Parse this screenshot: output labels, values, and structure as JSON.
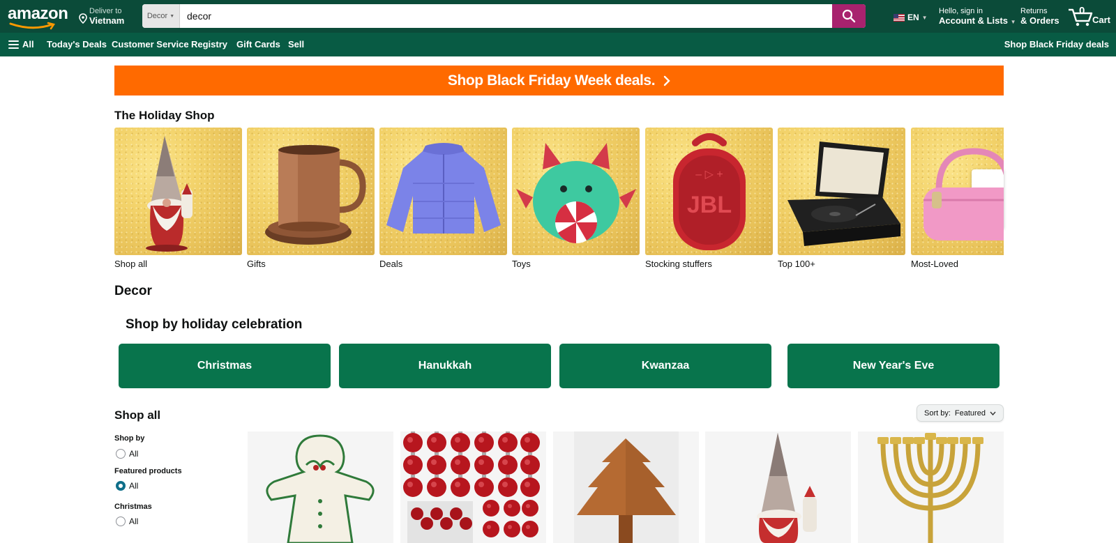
{
  "header": {
    "logo": "amazon",
    "deliver_line1": "Deliver to",
    "deliver_line2": "Vietnam",
    "search_department": "Decor",
    "search_value": "decor",
    "language": "EN",
    "account_line1": "Hello, sign in",
    "account_line2": "Account & Lists",
    "returns_line1": "Returns",
    "returns_line2": "& Orders",
    "cart_count": "0",
    "cart_label": "Cart"
  },
  "nav": {
    "all": "All",
    "items": [
      "Today's Deals",
      "Customer Service",
      "Registry",
      "Gift Cards",
      "Sell"
    ],
    "right": "Shop Black Friday deals"
  },
  "banner": {
    "text": "Shop Black Friday Week deals."
  },
  "holiday_shop": {
    "title": "The Holiday Shop",
    "cards": [
      "Shop all",
      "Gifts",
      "Deals",
      "Toys",
      "Stocking stuffers",
      "Top 100+",
      "Most-Loved"
    ]
  },
  "decor": {
    "title": "Decor",
    "celebration_title": "Shop by holiday celebration",
    "celebrations": [
      "Christmas",
      "Hanukkah",
      "Kwanzaa",
      "New Year's Eve"
    ]
  },
  "shop_all": {
    "title": "Shop all",
    "sort_label": "Sort by:",
    "sort_value": "Featured",
    "filters": [
      {
        "heading": "Shop by",
        "option": "All",
        "selected": false
      },
      {
        "heading": "Featured products",
        "option": "All",
        "selected": true
      },
      {
        "heading": "Christmas",
        "option": "All",
        "selected": false
      }
    ]
  },
  "colors": {
    "header_bg": "#0b4b39",
    "nav_bg": "#085b44",
    "search_button": "#a8226e",
    "banner": "#ff6a00",
    "celebration_button": "#08744c"
  }
}
